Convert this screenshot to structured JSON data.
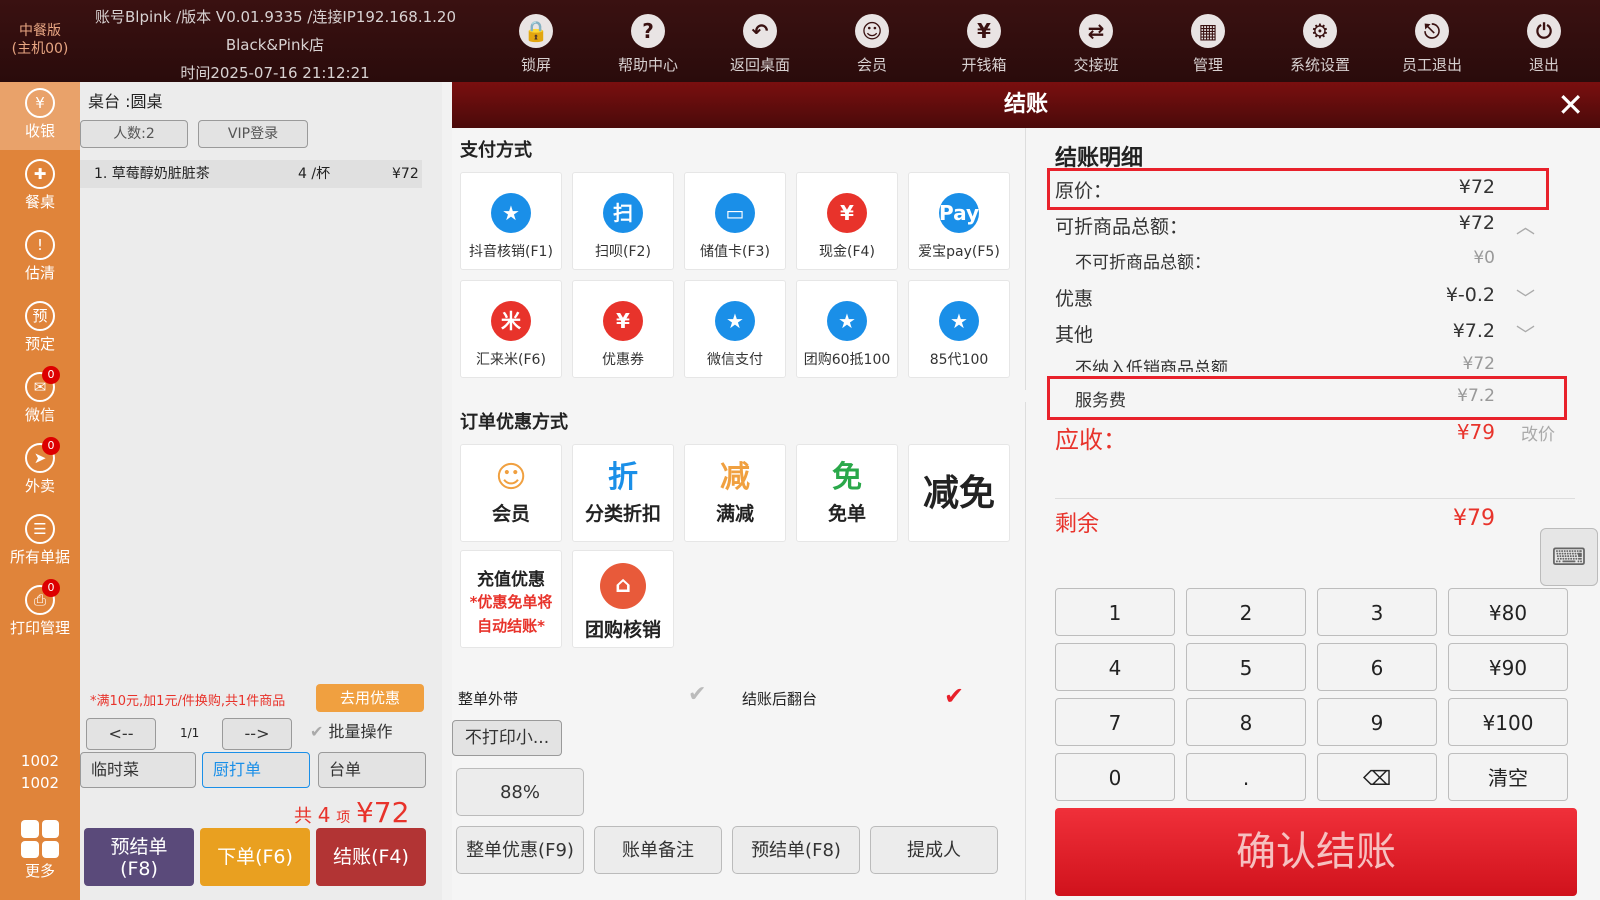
{
  "header": {
    "brand": "中餐版\n(主机00)",
    "account": "账号Blpink /版本 V0.01.9335 /连接IP192.168.1.20",
    "store": "Black&Pink店",
    "time": "时间2025-07-16 21:12:21",
    "buttons": [
      {
        "label": "锁屏",
        "icon": "lock-icon"
      },
      {
        "label": "帮助中心",
        "icon": "question-icon"
      },
      {
        "label": "返回桌面",
        "icon": "back-icon"
      },
      {
        "label": "会员",
        "icon": "member-icon"
      },
      {
        "label": "开钱箱",
        "icon": "cashbox-icon"
      },
      {
        "label": "交接班",
        "icon": "handover-icon"
      },
      {
        "label": "管理",
        "icon": "grid-icon"
      },
      {
        "label": "系统设置",
        "icon": "gear-icon"
      },
      {
        "label": "员工退出",
        "icon": "logout-icon"
      },
      {
        "label": "退出",
        "icon": "power-icon"
      }
    ]
  },
  "sidebar": {
    "items": [
      {
        "label": "收银",
        "icon": "¥"
      },
      {
        "label": "餐桌",
        "icon": "✚"
      },
      {
        "label": "估清",
        "icon": "!"
      },
      {
        "label": "预定",
        "icon": "预"
      },
      {
        "label": "微信",
        "icon": "✉",
        "badge": "0"
      },
      {
        "label": "外卖",
        "icon": "➤",
        "badge": "0"
      },
      {
        "label": "所有单据",
        "icon": "☰"
      },
      {
        "label": "打印管理",
        "icon": "⎙",
        "badge": "0"
      }
    ],
    "table_no_1": "1002",
    "table_no_2": "1002",
    "more": "更多"
  },
  "order": {
    "table": "桌台 :圆桌",
    "people": "人数:2",
    "vip": "VIP登录",
    "items": [
      {
        "name": "1. 草莓醇奶脏脏茶",
        "qty": "4 /杯",
        "price": "¥72"
      }
    ],
    "promo": "*满10元,加1元/件换购,共1件商品",
    "use_discount": "去用优惠",
    "prev": "<--",
    "page": "1/1",
    "next": "-->",
    "batch": "批量操作",
    "temp": "临时菜",
    "kitchen": "厨打单",
    "table_btn": "台单",
    "total_prefix": "共",
    "total_count": "4",
    "total_unit": "项",
    "total_amount": "¥72",
    "prebill": "预结单\n(F8)",
    "place": "下单(F6)",
    "checkout": "结账(F4)"
  },
  "modal": {
    "title": "结账",
    "pay_title": "支付方式",
    "pay_methods": [
      {
        "label": "抖音核销(F1)",
        "icon": "★",
        "color": "#1a8fe8"
      },
      {
        "label": "扫呗(F2)",
        "icon": "扫",
        "color": "#1a8fe8"
      },
      {
        "label": "储值卡(F3)",
        "icon": "▭",
        "color": "#1a8fe8"
      },
      {
        "label": "现金(F4)",
        "icon": "¥",
        "color": "#e8332b"
      },
      {
        "label": "爱宝pay(F5)",
        "icon": "Pay",
        "color": "#1a8fe8"
      },
      {
        "label": "汇来米(F6)",
        "icon": "米",
        "color": "#e8332b"
      },
      {
        "label": "优惠券",
        "icon": "¥",
        "color": "#e8332b"
      },
      {
        "label": "微信支付",
        "icon": "★",
        "color": "#1a8fe8"
      },
      {
        "label": "团购60抵100",
        "icon": "★",
        "color": "#1a8fe8"
      },
      {
        "label": "85代100",
        "icon": "★",
        "color": "#1a8fe8"
      }
    ],
    "disc_title": "订单优惠方式",
    "discounts": [
      {
        "label": "会员",
        "icon": "☺",
        "color": "#f0a040"
      },
      {
        "label": "分类折扣",
        "icon": "折",
        "color": "#1a8fe8"
      },
      {
        "label": "满减",
        "icon": "减",
        "color": "#f0a040"
      },
      {
        "label": "免单",
        "icon": "免",
        "color": "#2aa84a"
      },
      {
        "label": "减免",
        "icon": "",
        "color": "#222"
      }
    ],
    "recharge": {
      "title": "充值优惠",
      "note": "*优惠免单将自动结账*"
    },
    "groupbuy": "团购核销",
    "takeaway": "整单外带",
    "flip": "结账后翻台",
    "print": "不打印小...",
    "percent": "88%",
    "bottom": [
      "整单优惠(F9)",
      "账单备注",
      "预结单(F8)",
      "提成人"
    ],
    "detail_title": "结账明细",
    "original_label": "原价：",
    "original": "¥72",
    "discountable_label": "可折商品总额：",
    "discountable": "¥72",
    "nondisc_label": "不可折商品总额：",
    "nondisc": "¥0",
    "promo_label": "优惠",
    "promo": "¥-0.2",
    "other_label": "其他",
    "other": "¥7.2",
    "nolow_label": "不纳入低销商品总额",
    "nolow": "¥72",
    "service_label": "服务费",
    "service": "¥7.2",
    "receivable_label": "应收：",
    "receivable": "¥79",
    "edit_price": "改价",
    "remaining_label": "剩余",
    "remaining": "¥79",
    "keys": [
      "1",
      "2",
      "3",
      "¥80",
      "4",
      "5",
      "6",
      "¥90",
      "7",
      "8",
      "9",
      "¥100",
      "0",
      ".",
      "⌫",
      "清空"
    ],
    "confirm": "确认结账"
  }
}
